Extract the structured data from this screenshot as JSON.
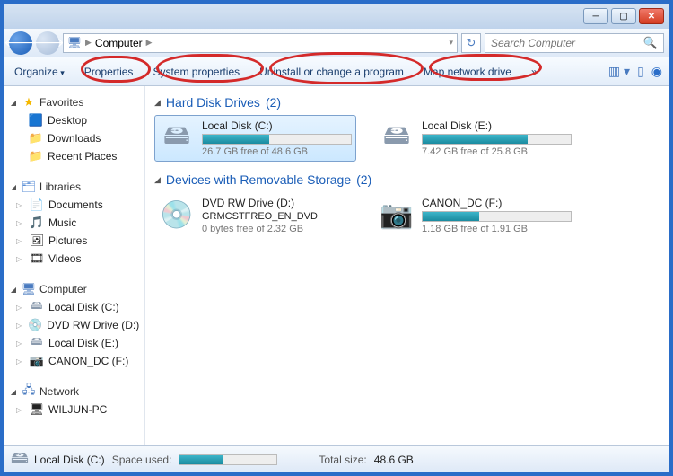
{
  "toolbar": {
    "organize": "Organize",
    "properties": "Properties",
    "system_properties": "System properties",
    "uninstall": "Uninstall or change a program",
    "map_drive": "Map network drive",
    "overflow": "»"
  },
  "address": {
    "root_icon": "🖥",
    "label": "Computer"
  },
  "search": {
    "placeholder": "Search Computer"
  },
  "sidebar": {
    "favorites": {
      "label": "Favorites",
      "items": [
        "Desktop",
        "Downloads",
        "Recent Places"
      ]
    },
    "libraries": {
      "label": "Libraries",
      "items": [
        "Documents",
        "Music",
        "Pictures",
        "Videos"
      ]
    },
    "computer": {
      "label": "Computer",
      "items": [
        "Local Disk (C:)",
        "DVD RW Drive (D:) G",
        "Local Disk (E:)",
        "CANON_DC (F:)"
      ]
    },
    "network": {
      "label": "Network",
      "items": [
        "WILJUN-PC"
      ]
    }
  },
  "groups": {
    "hdd": {
      "title": "Hard Disk Drives",
      "count": "(2)"
    },
    "removable": {
      "title": "Devices with Removable Storage",
      "count": "(2)"
    }
  },
  "drives": {
    "c": {
      "name": "Local Disk (C:)",
      "info": "26.7 GB free of 48.6 GB",
      "fill": 45
    },
    "e": {
      "name": "Local Disk (E:)",
      "info": "7.42 GB free of 25.8 GB",
      "fill": 71
    },
    "d": {
      "name": "DVD RW Drive (D:)",
      "sub": "GRMCSTFREO_EN_DVD",
      "info": "0 bytes free of 2.32 GB"
    },
    "f": {
      "name": "CANON_DC (F:)",
      "info": "1.18 GB free of 1.91 GB",
      "fill": 38
    }
  },
  "status": {
    "name": "Local Disk (C:)",
    "space_label": "Space used:",
    "total_label": "Total size:",
    "total_value": "48.6 GB"
  }
}
